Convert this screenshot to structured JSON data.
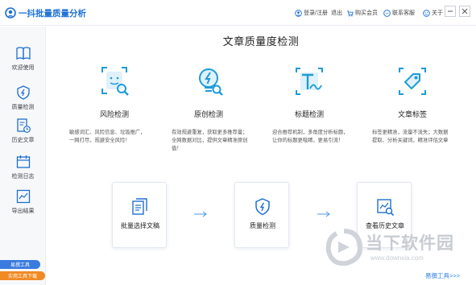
{
  "app": {
    "title": "一抖批量质量分析"
  },
  "titlebar": {
    "login": "登录/注册",
    "logout": "退出",
    "buy": "购买会员",
    "support": "联系客服",
    "about": "关于"
  },
  "sidebar": {
    "items": [
      {
        "label": "欢迎使用",
        "icon": "book-icon"
      },
      {
        "label": "质量检测",
        "icon": "shield-icon"
      },
      {
        "label": "历史文章",
        "icon": "history-icon"
      },
      {
        "label": "检测日志",
        "icon": "calendar-icon"
      },
      {
        "label": "导出结果",
        "icon": "chart-icon"
      }
    ],
    "badges": [
      {
        "label": "易撰工具"
      },
      {
        "label": "实用工具下载"
      }
    ]
  },
  "main": {
    "title": "文章质量度检测",
    "features": [
      {
        "name": "风险检测",
        "desc": [
          "敏感词汇、风险信息、垃圾推广，",
          "一网打尽，规避安全风险！"
        ]
      },
      {
        "name": "原创检测",
        "desc": [
          "有效规避重复，获取更多推荐量；",
          "全网数据对比，提供文章精准原创",
          "值！"
        ]
      },
      {
        "name": "标题检测",
        "desc": [
          "迎合推荐机制，多角度分析标题，",
          "让你的标题更吸睛，更易引流！"
        ]
      },
      {
        "name": "文章标签",
        "desc": [
          "标签更精准，流量不流失；大数据",
          "提取、分析关键词，精准评估文章"
        ]
      }
    ],
    "steps": [
      {
        "label": "批量选择文稿"
      },
      {
        "label": "质量检测"
      },
      {
        "label": "查看历史文章"
      }
    ],
    "more_link": "易撰工具>>>"
  },
  "watermark": {
    "text": "当下软件园",
    "url": "www.downxia.com"
  },
  "colors": {
    "accent": "#1a6fd6",
    "icon_blue": "#1e9bd7",
    "badge_blue": "#3a7be0",
    "badge_orange": "#f08a24"
  }
}
